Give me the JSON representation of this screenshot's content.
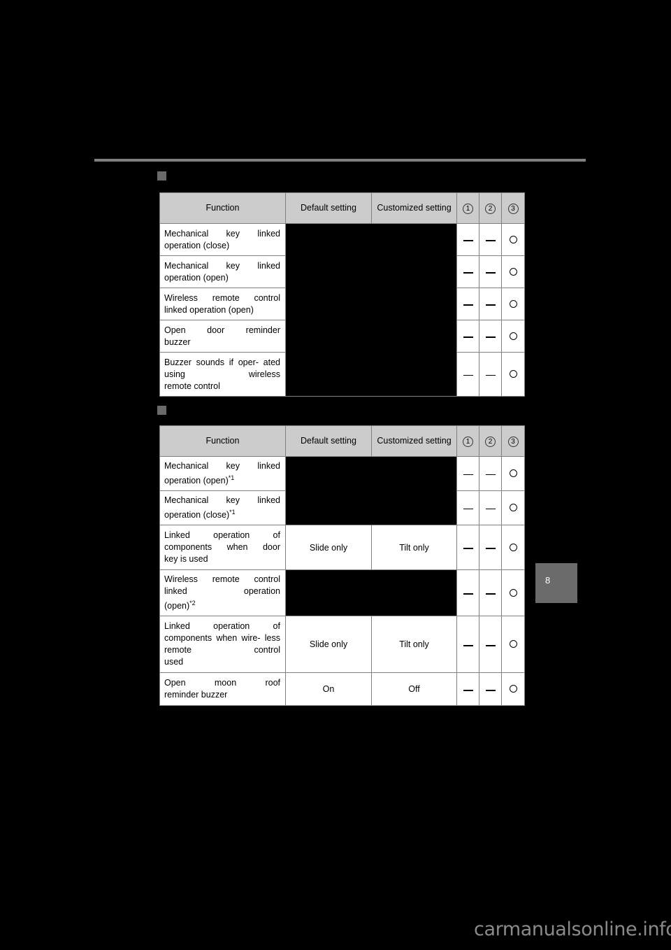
{
  "page": {
    "page_number": "8",
    "watermark": "carmanualsonline.info"
  },
  "legend": {
    "mark_available": "O",
    "mark_unavailable": "—",
    "circle_1": "1",
    "circle_2": "2",
    "circle_3": "3"
  },
  "tables": [
    {
      "id": "table-1",
      "headers": {
        "function": "Function",
        "default_setting": "Default setting",
        "customized_setting": "Customized setting",
        "col1": "1",
        "col2": "2",
        "col3": "3"
      },
      "rows": [
        {
          "function": "Mechanical key linked operation (close)",
          "function_lines": [
            "Mechanical key linked",
            "operation (close)"
          ],
          "default_setting": "",
          "customized_setting": "",
          "redacted": true,
          "col1": "—",
          "col2": "—",
          "col3": "O"
        },
        {
          "function": "Mechanical key linked operation (open)",
          "function_lines": [
            "Mechanical key linked",
            "operation (open)"
          ],
          "default_setting": "",
          "customized_setting": "",
          "redacted": true,
          "col1": "—",
          "col2": "—",
          "col3": "O"
        },
        {
          "function": "Wireless remote control linked operation (open)",
          "function_lines": [
            "Wireless remote control",
            "linked operation (open)"
          ],
          "default_setting": "",
          "customized_setting": "",
          "redacted": true,
          "col1": "—",
          "col2": "—",
          "col3": "O"
        },
        {
          "function": "Open door reminder buzzer",
          "function_lines": [
            "Open door reminder",
            "buzzer"
          ],
          "default_setting": "",
          "customized_setting": "",
          "redacted": true,
          "col1": "—",
          "col2": "—",
          "col3": "O"
        },
        {
          "function": "Buzzer sounds if operated using wireless remote control",
          "function_lines": [
            "Buzzer sounds if oper-",
            "ated using wireless",
            "remote control"
          ],
          "default_setting": "",
          "customized_setting": "",
          "redacted": true,
          "col1": "—",
          "col2": "—",
          "col3": "O"
        }
      ]
    },
    {
      "id": "table-2",
      "headers": {
        "function": "Function",
        "default_setting": "Default setting",
        "customized_setting": "Customized setting",
        "col1": "1",
        "col2": "2",
        "col3": "3"
      },
      "rows": [
        {
          "function": "Mechanical key linked operation (open)*1",
          "function_lines": [
            "Mechanical key linked",
            "operation (open)"
          ],
          "footnote": "*1",
          "default_setting": "",
          "customized_setting": "",
          "redacted": true,
          "col1": "—",
          "col2": "—",
          "col3": "O"
        },
        {
          "function": "Mechanical key linked operation (close)*1",
          "function_lines": [
            "Mechanical key linked",
            "operation (close)"
          ],
          "footnote": "*1",
          "default_setting": "",
          "customized_setting": "",
          "redacted": true,
          "col1": "—",
          "col2": "—",
          "col3": "O"
        },
        {
          "function": "Linked operation of components when door key is used",
          "function_lines": [
            "Linked operation of",
            "components when door",
            "key is used"
          ],
          "default_setting": "Slide only",
          "customized_setting": "Tilt only",
          "redacted": false,
          "col1": "—",
          "col2": "—",
          "col3": "O"
        },
        {
          "function": "Wireless remote control linked operation (open)*2",
          "function_lines": [
            "Wireless remote control",
            "linked operation",
            "(open)"
          ],
          "footnote": "*2",
          "default_setting": "",
          "customized_setting": "",
          "redacted": true,
          "col1": "—",
          "col2": "—",
          "col3": "O"
        },
        {
          "function": "Linked operation of components when wireless remote control used",
          "function_lines": [
            "Linked operation of",
            "components when wire-",
            "less remote control",
            "used"
          ],
          "default_setting": "Slide only",
          "customized_setting": "Tilt only",
          "redacted": false,
          "col1": "—",
          "col2": "—",
          "col3": "O"
        },
        {
          "function": "Open moon roof reminder buzzer",
          "function_lines": [
            "Open moon roof",
            "reminder buzzer"
          ],
          "default_setting": "On",
          "customized_setting": "Off",
          "redacted": false,
          "col1": "—",
          "col2": "—",
          "col3": "O"
        }
      ]
    }
  ]
}
